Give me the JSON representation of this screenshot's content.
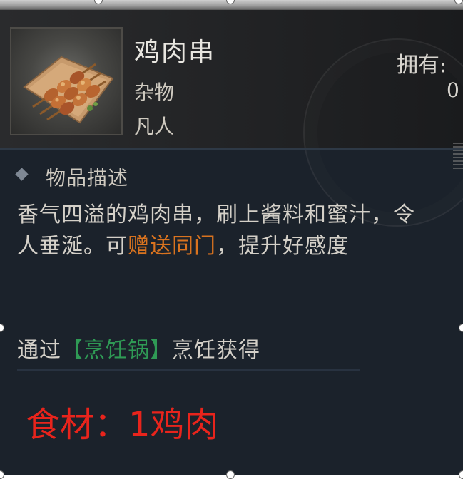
{
  "item": {
    "name": "鸡肉串",
    "type": "杂物",
    "grade": "凡人",
    "icon": "chicken-skewer-icon"
  },
  "ownership": {
    "label": "拥有:",
    "value": "0"
  },
  "description": {
    "section_title": "物品描述",
    "text_part1": "香气四溢的鸡肉串，刷上酱料和蜜汁，令人垂涎。可",
    "highlight": "赠送同门",
    "text_part2": "，提升好感度"
  },
  "source": {
    "prefix": "通过",
    "highlight": "【烹饪锅】",
    "suffix": "烹饪获得"
  },
  "ingredients": {
    "text": "食材：1鸡肉"
  },
  "colors": {
    "highlight_orange": "#d9731f",
    "highlight_green": "#2f9a55",
    "ingredient_red": "#e8241c",
    "panel_background": "#1b222b"
  }
}
